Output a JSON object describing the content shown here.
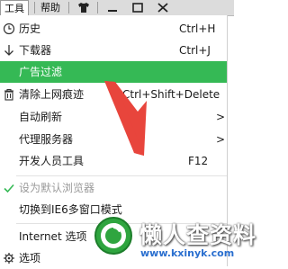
{
  "topbar": {
    "tools_menu": "工具",
    "help_menu": "帮助",
    "shirt_icon": "skin-icon",
    "minimize_icon": "minimize-icon",
    "maximize_icon": "maximize-icon",
    "close_icon": "close-icon"
  },
  "menu": {
    "history": {
      "label": "历史",
      "shortcut": "Ctrl+H",
      "icon": "clock-icon"
    },
    "downloads": {
      "label": "下载器",
      "shortcut": "Ctrl+J",
      "icon": "download-icon"
    },
    "adfilter": {
      "label": "广告过滤"
    },
    "clear_traces": {
      "label": "清除上网痕迹",
      "shortcut": "Ctrl+Shift+Delete",
      "icon": "trash-icon"
    },
    "auto_refresh": {
      "label": "自动刷新",
      "arrow": ">"
    },
    "proxy": {
      "label": "代理服务器",
      "arrow": ">"
    },
    "devtools": {
      "label": "开发人员工具",
      "shortcut": "F12"
    },
    "default_browser": {
      "label": "设为默认浏览器",
      "icon": "check-icon"
    },
    "ie6_mode": {
      "label": "切换到IE6多窗口模式"
    },
    "internet_options": {
      "label": "Internet 选项"
    },
    "options": {
      "label": "选项",
      "icon": "gear-icon"
    }
  },
  "colors": {
    "highlight": "#35b955",
    "arrow": "#e8453c"
  },
  "watermark": {
    "title": "懒人查资料",
    "url": "www.kxinyk.com"
  }
}
